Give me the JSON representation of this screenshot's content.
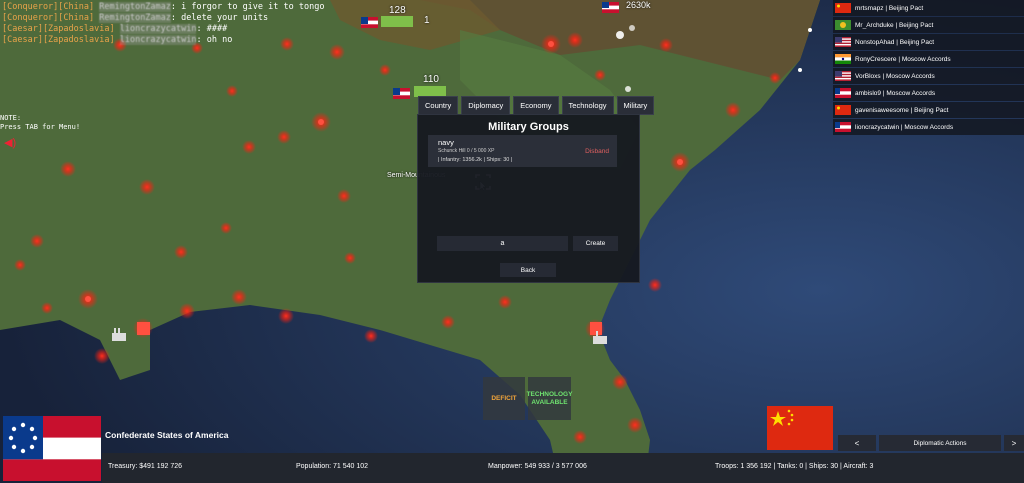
{
  "chat": [
    {
      "tag": "[Conqueror][China]",
      "user": "RemingtonZamaz",
      "message": "i forgor to give it to tongo"
    },
    {
      "tag": "[Conqueror][China]",
      "user": "RemingtonZamaz",
      "message": "delete your units"
    },
    {
      "tag": "[Caesar][Zapadoslavia]",
      "user": "lioncrazycatwin",
      "message": "####"
    },
    {
      "tag": "[Caesar][Zapadoslavia]",
      "user": "lioncrazycatwin",
      "message": "oh no"
    }
  ],
  "note": {
    "line1": "NOTE:",
    "line2": "Press TAB for Menu!"
  },
  "players": [
    {
      "name": "mrtsmapz | Beijing Pact",
      "flag": "china"
    },
    {
      "name": "Mr_Archduke | Beijing Pact",
      "flag": "green"
    },
    {
      "name": "NonstopAhad | Beijing Pact",
      "flag": "usa"
    },
    {
      "name": "RonyCrescere | Moscow Accords",
      "flag": "india"
    },
    {
      "name": "VorBloxs | Moscow Accords",
      "flag": "usa"
    },
    {
      "name": "ambislo9 | Moscow Accords",
      "flag": "redwhite"
    },
    {
      "name": "gavenisaweesome | Beijing Pact",
      "flag": "china"
    },
    {
      "name": "lioncrazycatwin | Moscow Accords",
      "flag": "redwhite"
    }
  ],
  "units": {
    "unit1_count": "128",
    "unit2_count": "110",
    "unit3_count": "2630k",
    "unit4_count": "1"
  },
  "terrain_label": "Semi-Mountainous",
  "tabs": [
    "Country",
    "Diplomacy",
    "Economy",
    "Technology",
    "Military"
  ],
  "panel": {
    "title": "Military Groups",
    "group": {
      "name": "navy",
      "xp": "Schunck Hill   0 / 5 000 XP",
      "stats": "| Infantry: 1356.2k | Ships: 30 |",
      "disband_label": "Disband"
    },
    "input_value": "a",
    "create_label": "Create",
    "back_label": "Back"
  },
  "alerts": {
    "deficit": "DEFICIT",
    "tech_line1": "TECHNOLOGY",
    "tech_line2": "AVAILABLE"
  },
  "country": {
    "name": "Confederate States of America"
  },
  "bottom": {
    "treasury": "Treasury:  $491 192 726",
    "population": "Population: 71 540 102",
    "manpower": "Manpower:  549 933  /  3 577 006",
    "forces": "Troops: 1 356 192  |  Tanks: 0  |  Ships: 30  |  Aircraft: 3"
  },
  "diplomacy": {
    "prev_label": "<",
    "actions_label": "Diplomatic Actions",
    "next_label": ">"
  },
  "colors": {
    "ocean": "#1d2a45",
    "land": "#4d6b3a",
    "accent_red": "#ff2a1a",
    "panel": "#16191f",
    "deficit": "#f2a53a",
    "tech": "#6fe36f"
  }
}
